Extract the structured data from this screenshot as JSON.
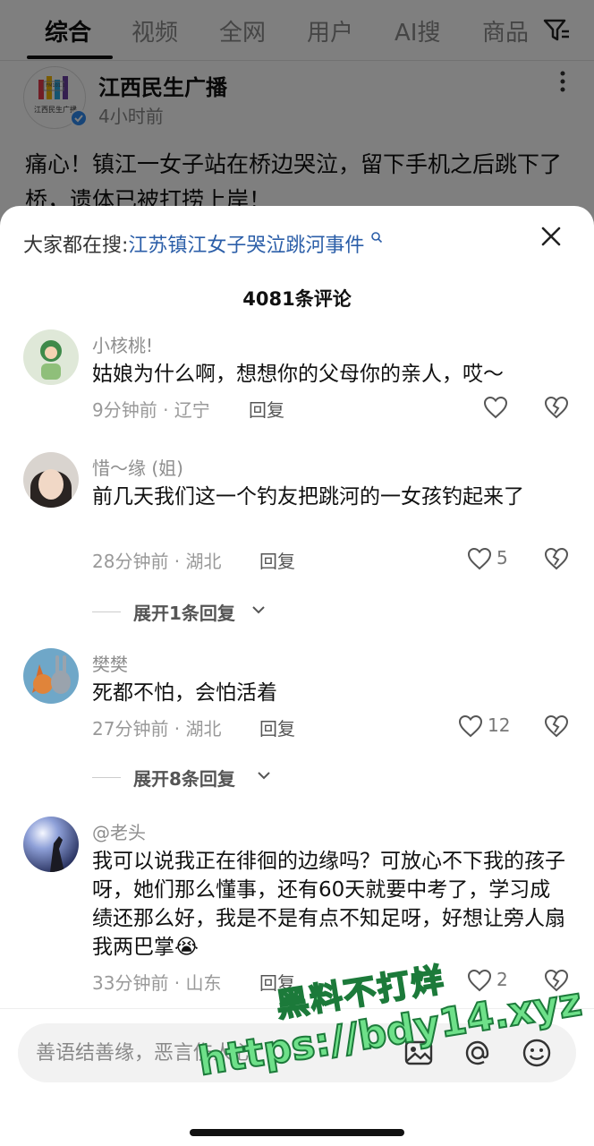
{
  "tabs": [
    "综合",
    "视频",
    "全网",
    "用户",
    "AI搜",
    "商品"
  ],
  "post": {
    "author": "江西民生广播",
    "time": "4小时前",
    "title": "痛心！镇江一女子站在桥边哭泣，留下手机之后跳下了桥，遗体已被打捞上岸！",
    "logo_text": "江西民生广播",
    "logo_freq": "FM101.1"
  },
  "sheet": {
    "hot_label": "大家都在搜:",
    "hot_link": "江苏镇江女子哭泣跳河事件",
    "comment_count": "4081条评论",
    "reply_label": "回复"
  },
  "comments": [
    {
      "name": "小核桃!",
      "text": "姑娘为什么啊，想想你的父母你的亲人，哎～",
      "meta": "9分钟前 · 辽宁",
      "likes": ""
    },
    {
      "name": "惜～缘 (姐)",
      "text": "前几天我们这一个钓友把跳河的一女孩钓起来了",
      "meta": "28分钟前 · 湖北",
      "likes": "5",
      "expand": "展开1条回复"
    },
    {
      "name": "樊樊",
      "text": "死都不怕，会怕活着",
      "meta": "27分钟前 · 湖北",
      "likes": "12",
      "expand": "展开8条回复"
    },
    {
      "name": "@老头",
      "text": "我可以说我正在徘徊的边缘吗？可放心不下我的孩子呀，她们那么懂事，还有60天就要中考了，学习成绩还那么好，我是不是有点不知足呀，好想让旁人扇我两巴掌😭",
      "meta": "33分钟前 · 山东",
      "likes": "2"
    }
  ],
  "input": {
    "placeholder": "善语结善缘，恶言伤人心"
  },
  "watermark": {
    "line1": "黑料不打烊",
    "line2": "https://bdy14.xyz"
  },
  "colors": {
    "link": "#2b5ea8",
    "verify": "#2f8bf0",
    "watermark": "#6ee089"
  }
}
